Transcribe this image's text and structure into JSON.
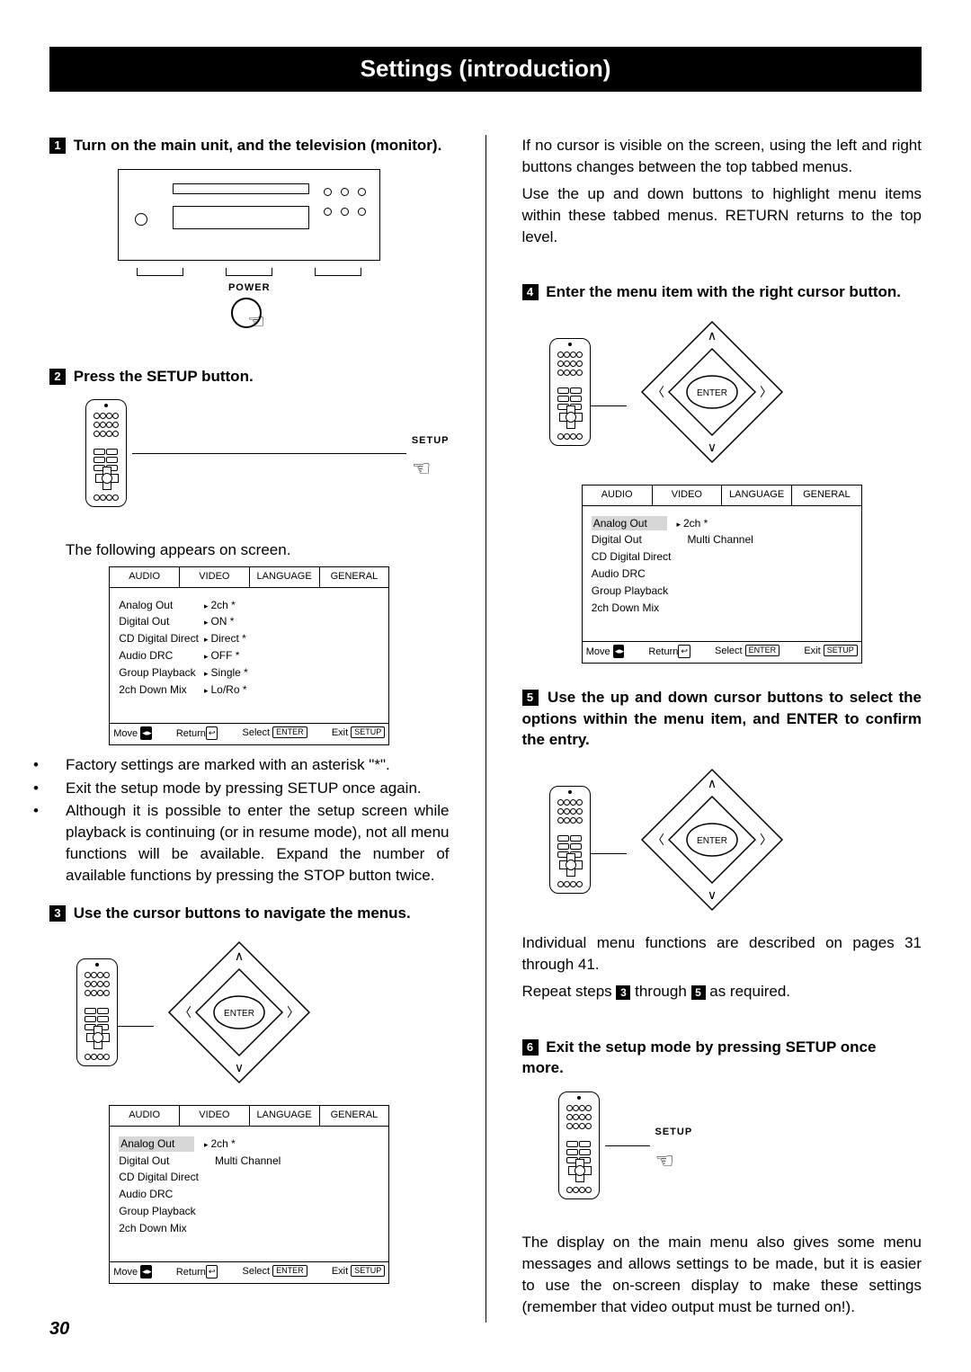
{
  "page_title": "Settings (introduction)",
  "page_number": "30",
  "steps": {
    "s1": "Turn on the main unit, and the television (monitor).",
    "s2": "Press the SETUP button.",
    "s3": "Use the cursor buttons to navigate the menus.",
    "s4": "Enter the menu item with the right cursor button.",
    "s5": "Use the up and down cursor buttons to select the options within the menu item, and ENTER to confirm the entry.",
    "s6": "Exit the setup mode by pressing SETUP once more."
  },
  "labels": {
    "power": "POWER",
    "setup": "SETUP",
    "enter": "ENTER"
  },
  "text": {
    "following_appears": "The following appears on screen.",
    "bullets": [
      "Factory settings are marked with an asterisk \"*\".",
      "Exit the setup mode by pressing SETUP once again.",
      "Although it is possible to enter the setup screen while playback is continuing (or in resume mode), not all menu functions will be available. Expand the number of available functions by pressing the STOP button twice."
    ],
    "no_cursor": "If no cursor is visible on the screen, using the left and right buttons changes between the top tabbed menus.",
    "use_up_down": "Use the up and down buttons to highlight menu items within these tabbed menus. RETURN returns to the top level.",
    "individual": "Individual menu functions are described on pages 31 through 41.",
    "repeat_a": "Repeat steps ",
    "repeat_b": " through ",
    "repeat_c": " as required.",
    "display_note": "The display on the main menu also gives some menu messages and allows settings to be made, but it is easier to use the on-screen display to make these settings (remember that video output must be turned on!)."
  },
  "osd": {
    "tabs": [
      "AUDIO",
      "VIDEO",
      "LANGUAGE",
      "GENERAL"
    ],
    "items_full": [
      [
        "Analog Out",
        "2ch *"
      ],
      [
        "Digital Out",
        "ON *"
      ],
      [
        "CD Digital Direct",
        "Direct *"
      ],
      [
        "Audio DRC",
        "OFF *"
      ],
      [
        "Group Playback",
        "Single *"
      ],
      [
        "2ch Down Mix",
        "Lo/Ro *"
      ]
    ],
    "items_sub": [
      [
        "Analog Out",
        "2ch *"
      ],
      [
        "Digital Out",
        "Multi Channel"
      ],
      [
        "CD Digital Direct",
        ""
      ],
      [
        "Audio DRC",
        ""
      ],
      [
        "Group Playback",
        ""
      ],
      [
        "2ch Down Mix",
        ""
      ]
    ],
    "footer": {
      "move": "Move",
      "return": "Return",
      "select": "Select",
      "enter": "ENTER",
      "exit": "Exit",
      "setup": "SETUP"
    }
  }
}
